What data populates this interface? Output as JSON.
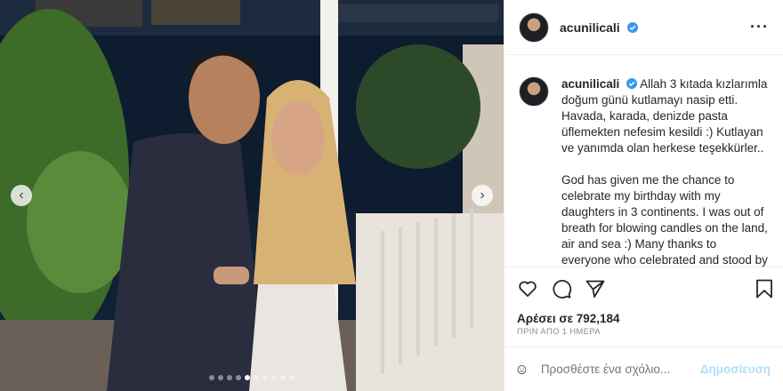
{
  "post": {
    "username": "acunilicali",
    "caption": "Allah 3 kıtada kızlarımla doğum günü kutlamayı nasip etti. Havada, karada, denizde pasta üflemekten nefesim kesildi :) Kutlayan ve yanımda olan herkese teşekkürler..\n\nGod has given me the chance to celebrate my birthday with my daughters in 3 continents. I was out of breath for blowing candles on the land, air and sea :) Many thanks to everyone who celebrated and stood by",
    "likes": "Αρέσει σε 792,184",
    "time_ago": "ΠΡΙΝ ΑΠΟ 1 ΗΜΕΡΑ",
    "comment_placeholder": "Προσθέστε ένα σχόλιο...",
    "post_button": "Δημοσίευση"
  },
  "carousel": {
    "slide_count": 10,
    "active_index": 4
  },
  "icons": {
    "verified": "verified-badge-icon",
    "more": "more-options-icon",
    "like": "heart-icon",
    "comment": "comment-icon",
    "share": "send-icon",
    "save": "bookmark-icon",
    "emoji": "emoji-icon",
    "prev": "chevron-left-icon",
    "next": "chevron-right-icon"
  },
  "colors": {
    "verified": "#3897f0",
    "post_button": "#b2dffc",
    "muted": "#8e8e8e",
    "text": "#262626"
  }
}
